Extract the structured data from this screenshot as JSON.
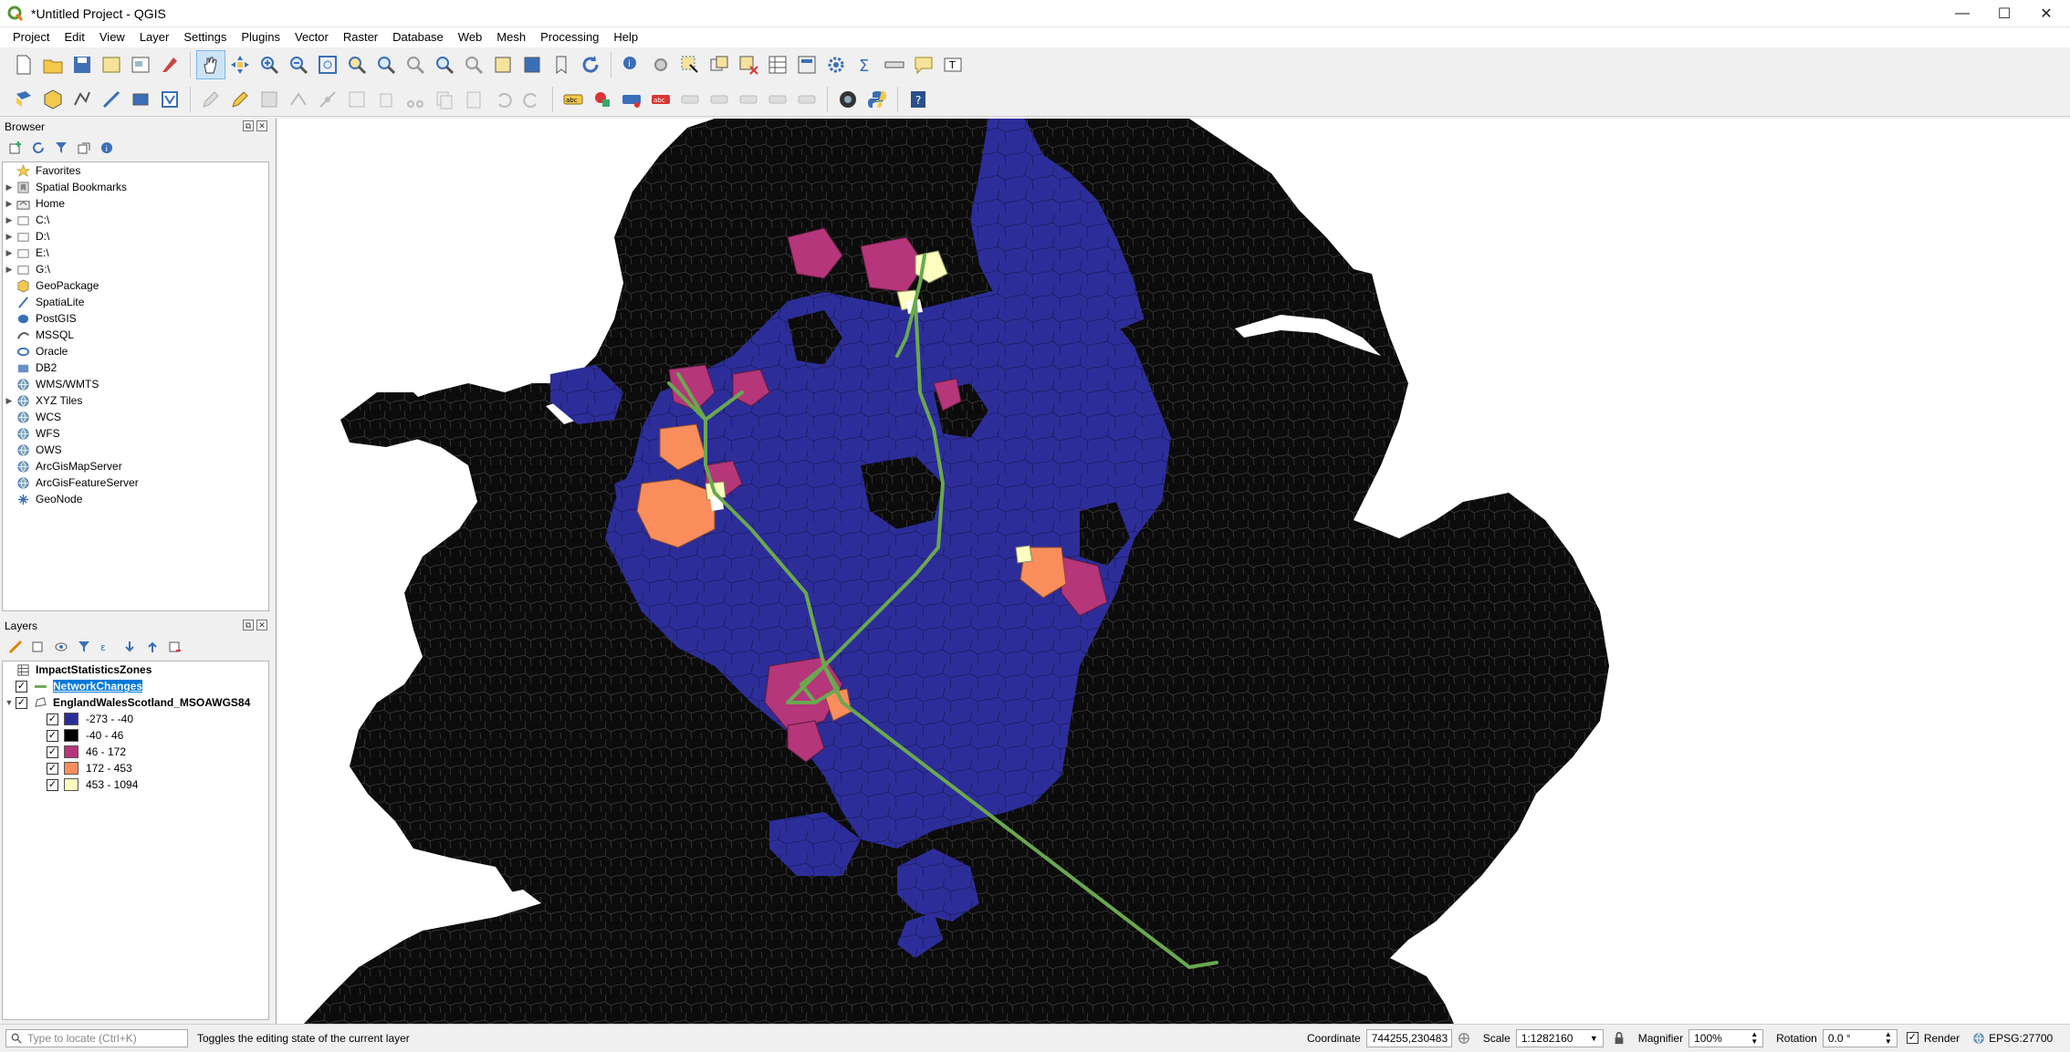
{
  "window": {
    "title": "*Untitled Project - QGIS",
    "controls": [
      "—",
      "☐",
      "✕"
    ]
  },
  "menu": [
    "Project",
    "Edit",
    "View",
    "Layer",
    "Settings",
    "Plugins",
    "Vector",
    "Raster",
    "Database",
    "Web",
    "Mesh",
    "Processing",
    "Help"
  ],
  "browser": {
    "title": "Browser",
    "items": [
      {
        "label": "Favorites",
        "icon": "star-icon",
        "expand": false
      },
      {
        "label": "Spatial Bookmarks",
        "icon": "bookmark-icon",
        "expand": true
      },
      {
        "label": "Home",
        "icon": "home-folder-icon",
        "expand": true
      },
      {
        "label": "C:\\",
        "icon": "drive-icon",
        "expand": true
      },
      {
        "label": "D:\\",
        "icon": "drive-icon",
        "expand": true
      },
      {
        "label": "E:\\",
        "icon": "drive-icon",
        "expand": true
      },
      {
        "label": "G:\\",
        "icon": "drive-icon",
        "expand": true
      },
      {
        "label": "GeoPackage",
        "icon": "geopackage-icon",
        "expand": false
      },
      {
        "label": "SpatiaLite",
        "icon": "spatialite-icon",
        "expand": false
      },
      {
        "label": "PostGIS",
        "icon": "postgis-icon",
        "expand": false
      },
      {
        "label": "MSSQL",
        "icon": "mssql-icon",
        "expand": false
      },
      {
        "label": "Oracle",
        "icon": "oracle-icon",
        "expand": false
      },
      {
        "label": "DB2",
        "icon": "db2-icon",
        "expand": false
      },
      {
        "label": "WMS/WMTS",
        "icon": "globe-icon",
        "expand": false
      },
      {
        "label": "XYZ Tiles",
        "icon": "globe-icon",
        "expand": true
      },
      {
        "label": "WCS",
        "icon": "globe-icon",
        "expand": false
      },
      {
        "label": "WFS",
        "icon": "globe-icon",
        "expand": false
      },
      {
        "label": "OWS",
        "icon": "globe-icon",
        "expand": false
      },
      {
        "label": "ArcGisMapServer",
        "icon": "globe-icon",
        "expand": false
      },
      {
        "label": "ArcGisFeatureServer",
        "icon": "globe-icon",
        "expand": false
      },
      {
        "label": "GeoNode",
        "icon": "geonode-icon",
        "expand": false
      }
    ]
  },
  "layers": {
    "title": "Layers",
    "items": [
      {
        "label": "ImpactStatisticsZones",
        "checked": null,
        "selected": false
      },
      {
        "label": "NetworkChanges",
        "checked": true,
        "selected": true
      },
      {
        "label": "EnglandWalesScotland_MSOAWGS84",
        "checked": true,
        "selected": false
      }
    ],
    "legend": [
      {
        "label": "-273 - -40",
        "color": "#2d2d9a"
      },
      {
        "label": "-40 - 46",
        "color": "#000000"
      },
      {
        "label": "46 - 172",
        "color": "#b5367a"
      },
      {
        "label": "172 - 453",
        "color": "#f98e5c"
      },
      {
        "label": "453 - 1094",
        "color": "#fcfdbf"
      }
    ]
  },
  "status": {
    "locate_placeholder": "Type to locate (Ctrl+K)",
    "message": "Toggles the editing state of the current layer",
    "coordinate_label": "Coordinate",
    "coordinate": "744255,230483",
    "scale_label": "Scale",
    "scale": "1:1282160",
    "magnifier_label": "Magnifier",
    "magnifier": "100%",
    "rotation_label": "Rotation",
    "rotation": "0.0 °",
    "render_label": "Render",
    "crs": "EPSG:27700"
  },
  "colors": {
    "land": "#0c0c0c",
    "decrease": "#2d2d9a",
    "network": "#6aa84f",
    "sea": "#ffffff"
  }
}
